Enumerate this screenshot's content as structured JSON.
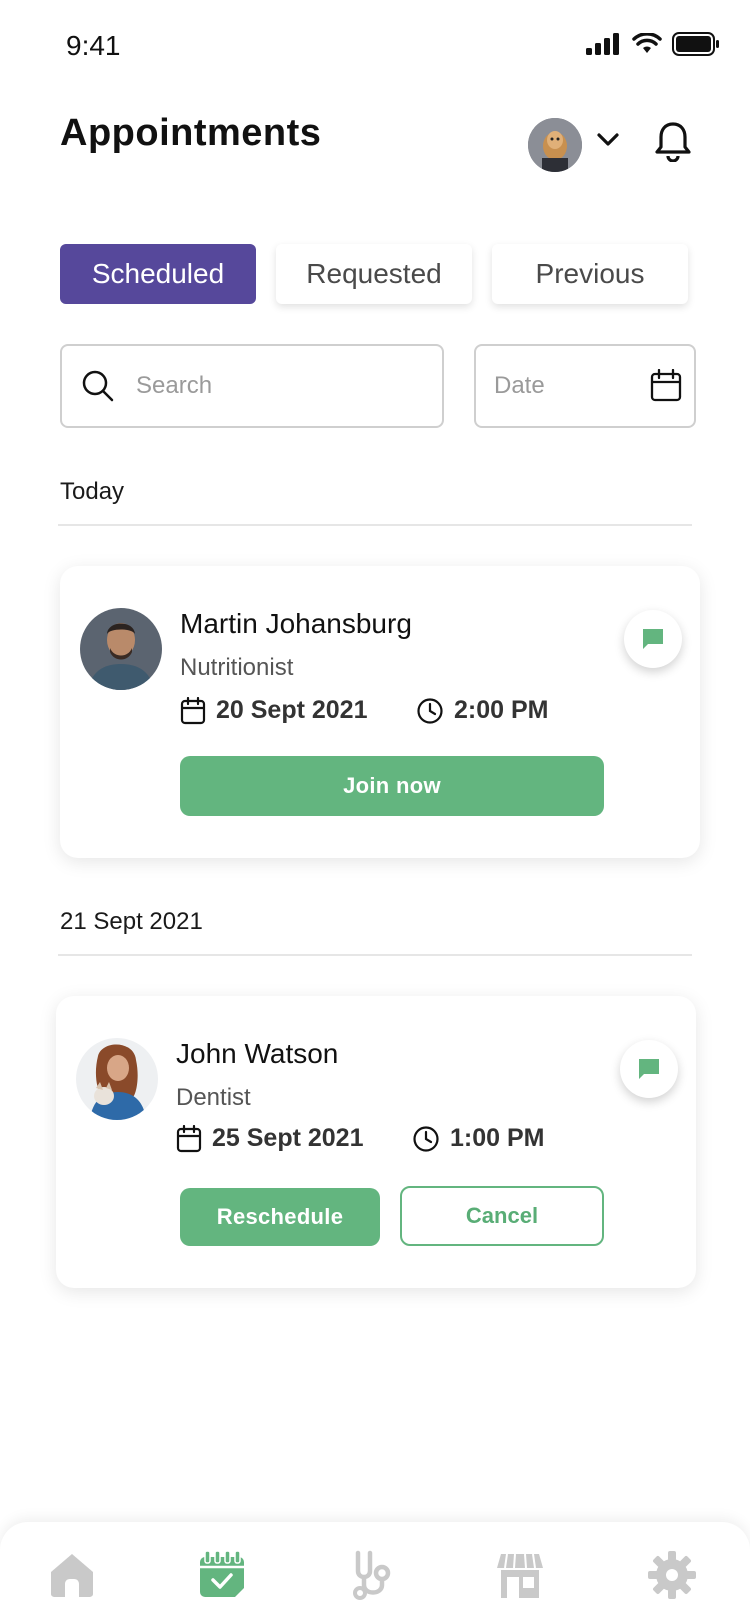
{
  "status_bar": {
    "time": "9:41",
    "icons": [
      "signal-icon",
      "wifi-icon",
      "battery-icon"
    ]
  },
  "header": {
    "title": "Appointments",
    "icons": [
      "profile-avatar",
      "chevron-down-icon",
      "bell-icon"
    ]
  },
  "tabs": [
    {
      "label": "Scheduled",
      "active": true
    },
    {
      "label": "Requested",
      "active": false
    },
    {
      "label": "Previous",
      "active": false
    }
  ],
  "search": {
    "placeholder": "Search",
    "value": ""
  },
  "date_filter": {
    "placeholder": "Date",
    "value": ""
  },
  "sections": [
    {
      "label": "Today",
      "appointment": {
        "name": "Martin Johansburg",
        "role": "Nutritionist",
        "date": "20 Sept 2021",
        "time": "2:00 PM",
        "primary_action": "Join now"
      }
    },
    {
      "label": "21 Sept 2021",
      "appointment": {
        "name": "John Watson",
        "role": "Dentist",
        "date": "25 Sept 2021",
        "time": "1:00 PM",
        "primary_action": "Reschedule",
        "secondary_action": "Cancel"
      }
    }
  ],
  "bottom_nav": {
    "items": [
      "home-icon",
      "appointments-calendar-icon",
      "stethoscope-icon",
      "store-icon",
      "settings-gear-icon"
    ],
    "active_index": 1
  },
  "colors": {
    "accent_purple": "#56489b",
    "accent_green": "#63b57f",
    "nav_inactive": "#c9c9c9"
  }
}
